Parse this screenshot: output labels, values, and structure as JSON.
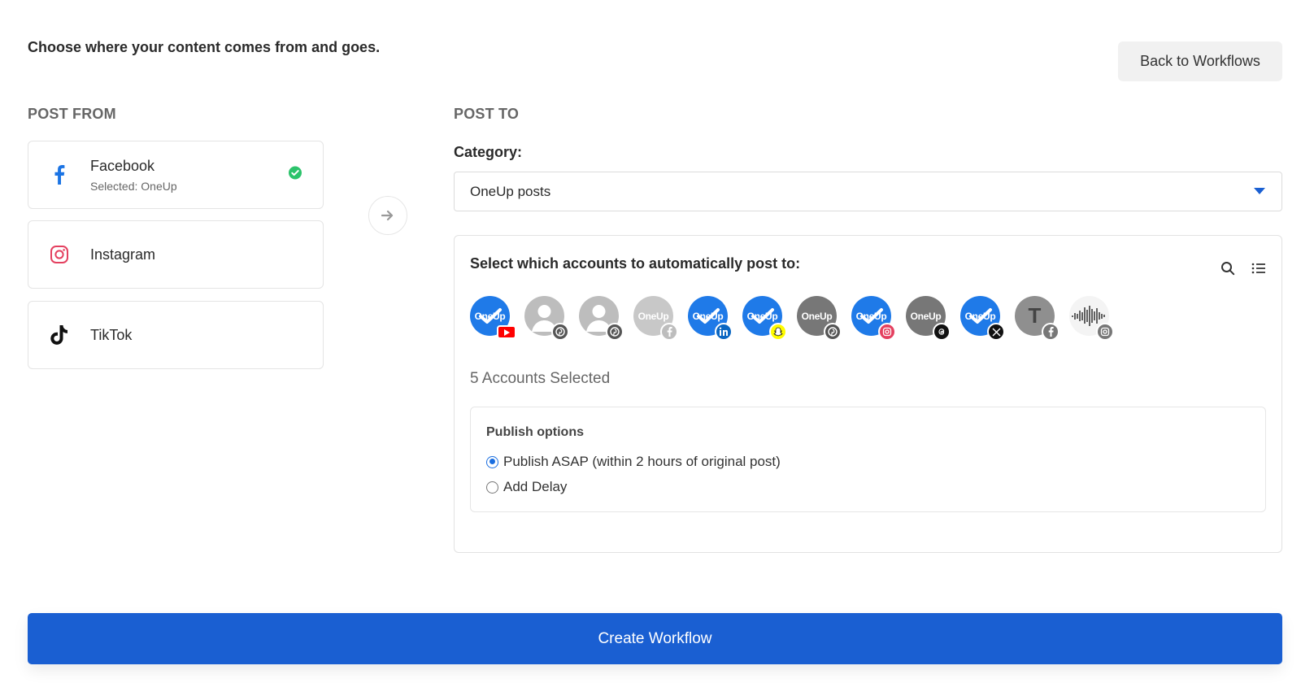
{
  "intro": "Choose where your content comes from and goes.",
  "back_button": "Back to Workflows",
  "post_from": {
    "heading": "POST FROM",
    "sources": [
      {
        "name": "Facebook",
        "sub": "Selected: OneUp",
        "icon": "facebook-icon",
        "selected": true
      },
      {
        "name": "Instagram",
        "sub": "",
        "icon": "instagram-icon",
        "selected": false
      },
      {
        "name": "TikTok",
        "sub": "",
        "icon": "tiktok-icon",
        "selected": false
      }
    ]
  },
  "post_to": {
    "heading": "POST TO",
    "category_label": "Category:",
    "category_value": "OneUp posts",
    "accounts_title": "Select which accounts to automatically post to:",
    "accounts": [
      {
        "label": "OneUp",
        "network": "youtube",
        "selected": true
      },
      {
        "label": "",
        "network": "pinterest",
        "selected": false
      },
      {
        "label": "",
        "network": "pinterest",
        "selected": false
      },
      {
        "label": "OneUp",
        "network": "facebook",
        "selected": false
      },
      {
        "label": "OneUp",
        "network": "linkedin",
        "selected": true
      },
      {
        "label": "OneUp",
        "network": "snapchat",
        "selected": true
      },
      {
        "label": "OneUp",
        "network": "pinterest",
        "selected": false
      },
      {
        "label": "OneUp",
        "network": "instagram",
        "selected": true
      },
      {
        "label": "OneUp",
        "network": "threads",
        "selected": false
      },
      {
        "label": "OneUp",
        "network": "x",
        "selected": true
      },
      {
        "label": "T",
        "network": "facebook",
        "selected": false
      },
      {
        "label": "",
        "network": "instagram",
        "selected": false
      }
    ],
    "selected_count": "5 Accounts Selected",
    "publish": {
      "title": "Publish options",
      "options": [
        {
          "label": "Publish ASAP (within 2 hours of original post)",
          "checked": true
        },
        {
          "label": "Add Delay",
          "checked": false
        }
      ]
    }
  },
  "create_button": "Create Workflow",
  "colors": {
    "accent": "#1a5fd2",
    "selected_avatar": "#1f7ae8",
    "check_green": "#2cc36b"
  }
}
